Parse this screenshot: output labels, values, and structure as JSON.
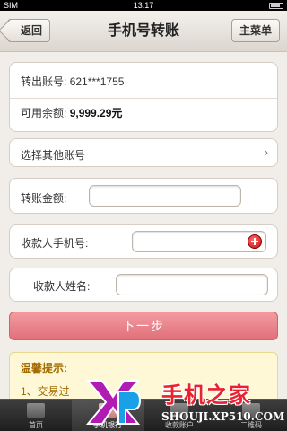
{
  "status_bar": {
    "carrier": "SIM",
    "time": "13:17"
  },
  "nav": {
    "back_label": "返回",
    "title": "手机号转账",
    "menu_label": "主菜单"
  },
  "account": {
    "from_label": "转出账号:",
    "from_value": "621***1755",
    "balance_label": "可用余额:",
    "balance_value": "9,999.29元"
  },
  "select_other": {
    "label": "选择其他账号",
    "chevron": "›"
  },
  "form": {
    "amount_label": "转账金额:",
    "amount_value": "",
    "phone_label": "收款人手机号:",
    "phone_value": "",
    "name_label": "收款人姓名:",
    "name_value": ""
  },
  "next_button": {
    "label": "下一步"
  },
  "tips": {
    "title": "温馨提示:",
    "line1": "1、交易过"
  },
  "tabbar": {
    "items": [
      {
        "label": "首页",
        "icon": "home-icon"
      },
      {
        "label": "手机银行",
        "icon": "phone-icon"
      },
      {
        "label": "收款账户",
        "icon": "account-icon"
      },
      {
        "label": "二维码",
        "icon": "qr-icon"
      }
    ]
  },
  "watermark": {
    "brand": "手机之家",
    "url": "SHOUJI.XP510.COM",
    "brand_color": "#e8222e"
  }
}
